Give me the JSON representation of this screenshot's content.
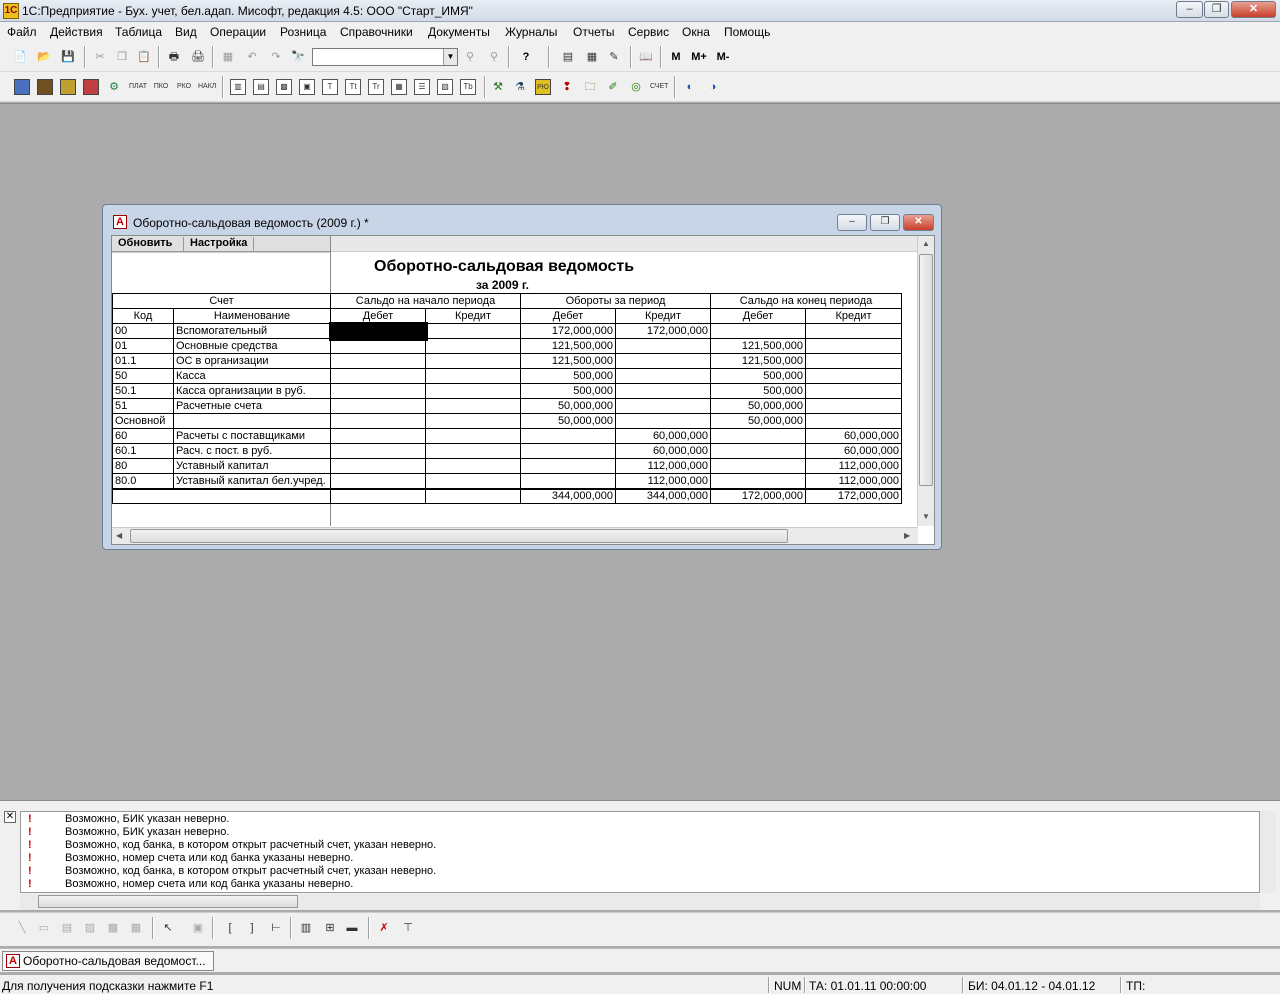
{
  "window": {
    "title": "1С:Предприятие - Бух. учет, бел.адап. Мисофт, редакция 4.5: ООО \"Старт_ИМЯ\"",
    "min_glyph": "‒",
    "max_glyph": "❐",
    "close_glyph": "✕"
  },
  "menu": [
    {
      "label": "Файл"
    },
    {
      "label": "Действия"
    },
    {
      "label": "Таблица"
    },
    {
      "label": "Вид"
    },
    {
      "label": "Операции"
    },
    {
      "label": "Розница"
    },
    {
      "label": "Справочники"
    },
    {
      "label": "Документы"
    },
    {
      "label": "Журналы"
    },
    {
      "label": "Отчеты"
    },
    {
      "label": "Сервис"
    },
    {
      "label": "Окна"
    },
    {
      "label": "Помощь"
    }
  ],
  "toolbar1": {
    "icons": [
      "new-icon",
      "open-icon",
      "save-icon",
      "cut-icon",
      "copy-icon",
      "paste-icon",
      "print-icon",
      "print-preview-icon",
      "properties-icon",
      "undo-icon",
      "redo-icon",
      "find-icon"
    ],
    "search_value": "",
    "m_label": "M",
    "mplus_label": "M+",
    "mminus_label": "M-",
    "help_glyph": "?"
  },
  "toolbar2": {
    "labels": [
      "ПЛАТ",
      "ПКО",
      "РКО",
      "НАКЛ",
      "СЧЕТ"
    ]
  },
  "report_window": {
    "title": "Оборотно-сальдовая ведомость (2009 г.)  *",
    "buttons": {
      "refresh": "Обновить",
      "settings": "Настройка"
    },
    "report_title": "Оборотно-сальдовая ведомость",
    "report_period": "за 2009 г.",
    "headers": {
      "account": "Счет",
      "opening": "Сальдо на начало периода",
      "turnover": "Обороты за период",
      "closing": "Сальдо на конец периода",
      "code": "Код",
      "name": "Наименование",
      "debit": "Дебет",
      "credit": "Кредит"
    },
    "rows": [
      {
        "code": "00",
        "name": "Вспомогательный",
        "od": "",
        "oc": "",
        "td": "172,000,000",
        "tc": "172,000,000",
        "cd": "",
        "cc": ""
      },
      {
        "code": "01",
        "name": "Основные средства",
        "od": "",
        "oc": "",
        "td": "121,500,000",
        "tc": "",
        "cd": "121,500,000",
        "cc": ""
      },
      {
        "code": "01.1",
        "name": "ОС в организации",
        "od": "",
        "oc": "",
        "td": "121,500,000",
        "tc": "",
        "cd": "121,500,000",
        "cc": ""
      },
      {
        "code": "50",
        "name": "Касса",
        "od": "",
        "oc": "",
        "td": "500,000",
        "tc": "",
        "cd": "500,000",
        "cc": ""
      },
      {
        "code": "50.1",
        "name": "Касса организации в руб.",
        "od": "",
        "oc": "",
        "td": "500,000",
        "tc": "",
        "cd": "500,000",
        "cc": ""
      },
      {
        "code": "51",
        "name": "Расчетные счета",
        "od": "",
        "oc": "",
        "td": "50,000,000",
        "tc": "",
        "cd": "50,000,000",
        "cc": ""
      },
      {
        "code": "Основной",
        "name": "",
        "od": "",
        "oc": "",
        "td": "50,000,000",
        "tc": "",
        "cd": "50,000,000",
        "cc": ""
      },
      {
        "code": "60",
        "name": "Расчеты с поставщиками",
        "od": "",
        "oc": "",
        "td": "",
        "tc": "60,000,000",
        "cd": "",
        "cc": "60,000,000"
      },
      {
        "code": "60.1",
        "name": "Расч. с пост. в руб.",
        "od": "",
        "oc": "",
        "td": "",
        "tc": "60,000,000",
        "cd": "",
        "cc": "60,000,000"
      },
      {
        "code": "80",
        "name": "Уставный капитал",
        "od": "",
        "oc": "",
        "td": "",
        "tc": "112,000,000",
        "cd": "",
        "cc": "112,000,000"
      },
      {
        "code": "80.0",
        "name": "Уставный капитал бел.учред.",
        "od": "",
        "oc": "",
        "td": "",
        "tc": "112,000,000",
        "cd": "",
        "cc": "112,000,000"
      }
    ],
    "total": {
      "od": "",
      "oc": "",
      "td": "344,000,000",
      "tc": "344,000,000",
      "cd": "172,000,000",
      "cc": "172,000,000"
    }
  },
  "messages": {
    "close_glyph": "✕",
    "bang": "!",
    "lines": [
      "Возможно, БИК указан неверно.",
      "Возможно, БИК указан неверно.",
      "Возможно, код банка, в котором открыт расчетный счет, указан неверно.",
      "Возможно, номер счета или код банка указаны неверно.",
      "Возможно, код банка, в котором открыт расчетный счет, указан неверно.",
      "Возможно, номер счета или код банка указаны неверно."
    ]
  },
  "taskbar": {
    "item": "Оборотно-сальдовая ведомост..."
  },
  "status": {
    "hint": "Для получения подсказки нажмите F1",
    "num": "NUM",
    "ta": "ТА: 01.01.11  00:00:00",
    "bi": "БИ: 04.01.12 - 04.01.12",
    "tp": "ТП:"
  },
  "colors": {
    "accent": "#c8402a",
    "window_frame": "#c8d5e6",
    "workspace": "#ababab"
  }
}
